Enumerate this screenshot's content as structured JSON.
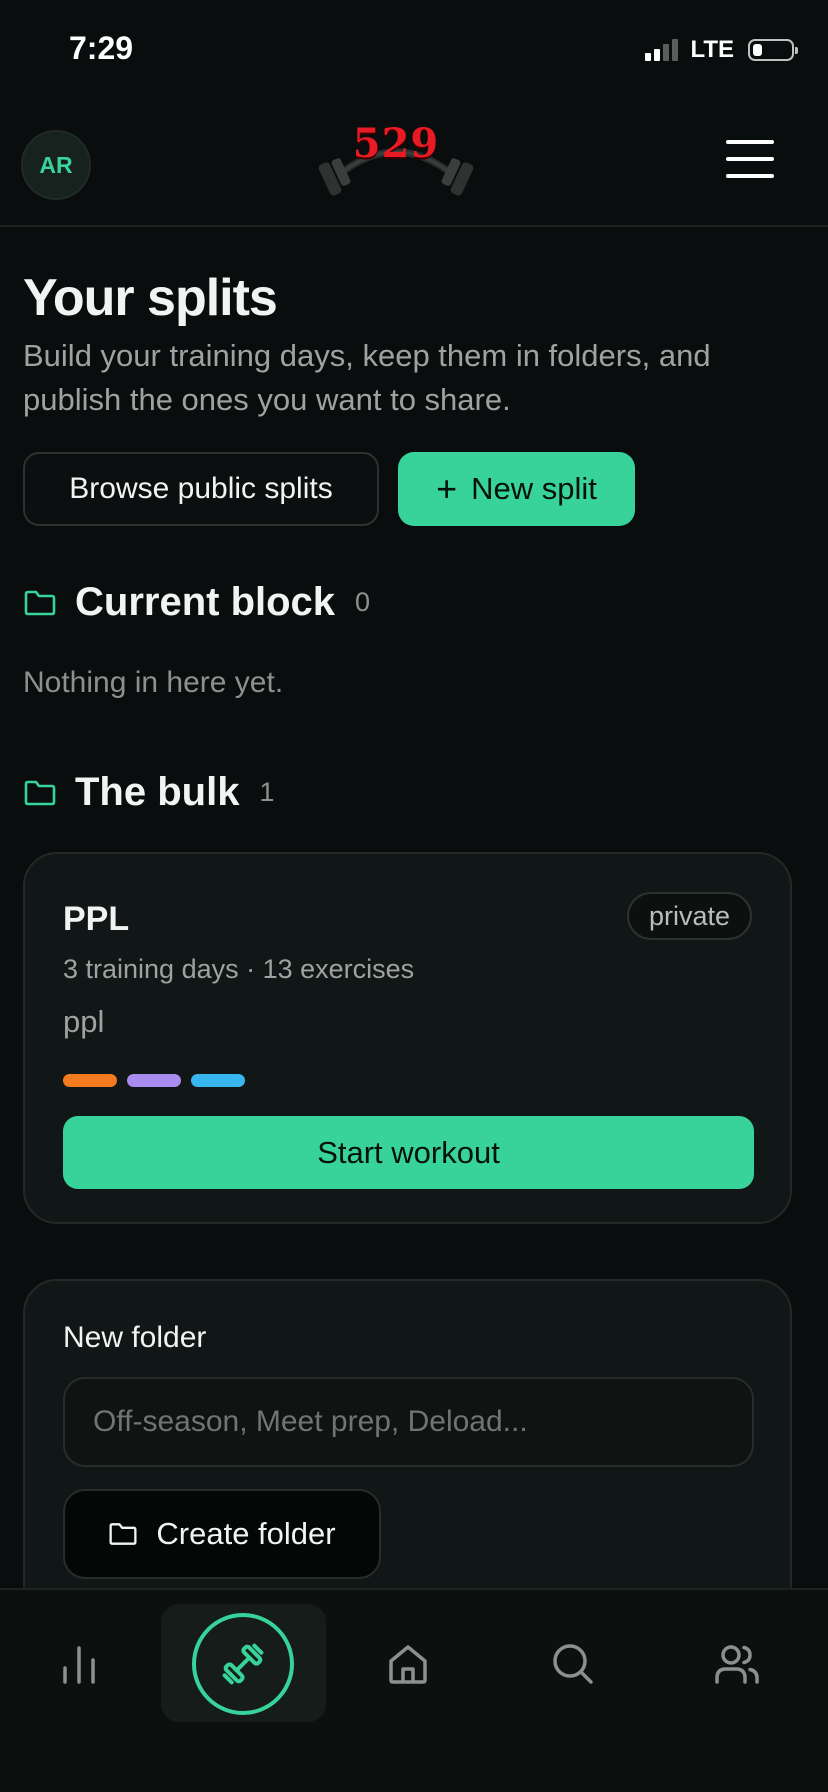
{
  "status_bar": {
    "time": "7:29",
    "network": "LTE"
  },
  "header": {
    "avatar_initials": "AR",
    "logo_text": "529",
    "logo_icon": "barbell-icon",
    "menu_icon": "hamburger-menu-icon"
  },
  "page": {
    "title": "Your splits",
    "subtitle": "Build your training days, keep them in folders, and publish the ones you want to share.",
    "browse_button": "Browse public splits",
    "new_split_button": "New split",
    "new_split_icon": "plus-icon"
  },
  "folders": [
    {
      "name": "Current block",
      "count": "0",
      "empty_text": "Nothing in here yet."
    },
    {
      "name": "The bulk",
      "count": "1",
      "splits": [
        {
          "name": "PPL",
          "visibility": "private",
          "meta": "3 training days · 13 exercises",
          "description": "ppl",
          "day_colors": [
            "#f47b20",
            "#a98cf0",
            "#38b6f0"
          ],
          "start_button": "Start workout"
        }
      ]
    }
  ],
  "new_folder": {
    "label": "New folder",
    "placeholder": "Off-season, Meet prep, Deload...",
    "value": "",
    "create_button": "Create folder"
  },
  "bottom_nav": [
    {
      "icon": "bar-chart-icon",
      "active": false
    },
    {
      "icon": "dumbbell-icon",
      "active": true
    },
    {
      "icon": "home-icon",
      "active": false
    },
    {
      "icon": "search-icon",
      "active": false
    },
    {
      "icon": "users-icon",
      "active": false
    }
  ],
  "colors": {
    "accent": "#37d39b",
    "background": "#0a0d0d",
    "card": "#111716"
  }
}
